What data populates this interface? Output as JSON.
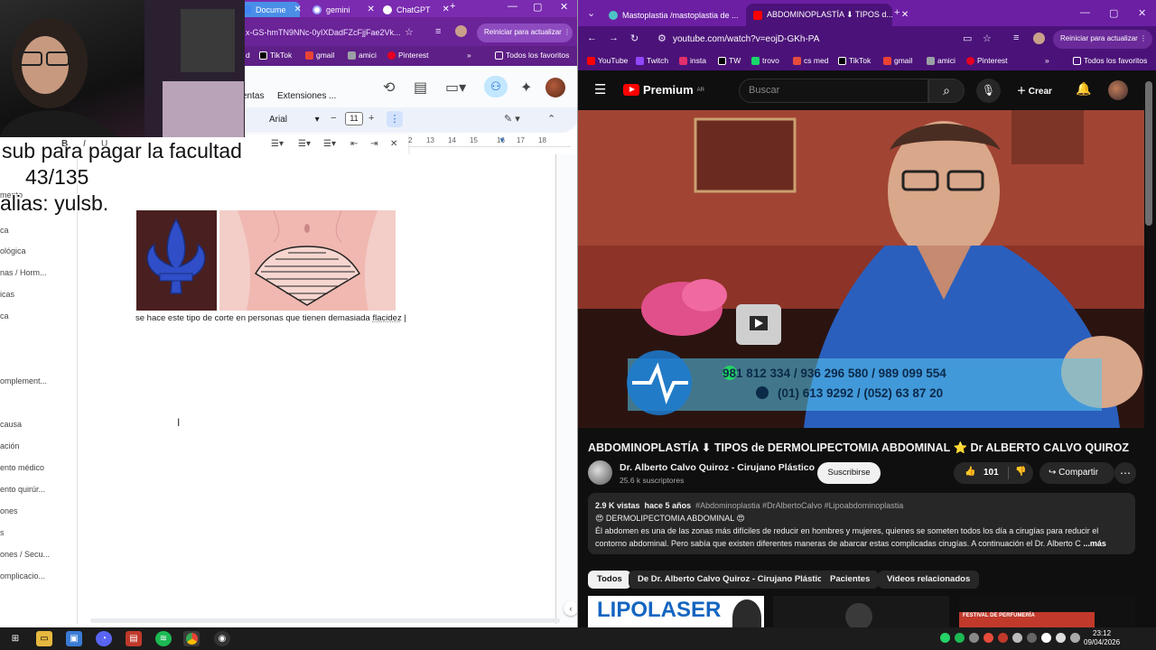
{
  "left_window": {
    "tabs": [
      {
        "label": "Docume",
        "active": true
      },
      {
        "label": "gemini",
        "active": false
      },
      {
        "label": "ChatGPT",
        "active": false
      }
    ],
    "url_fragment": "x-GS-hmTN9NNc-0yIXDadFZcFjjFae2Vk...",
    "update_button": "Reiniciar para actualizar",
    "bookmarks": [
      "d",
      "TikTok",
      "gmail",
      "amici",
      "Pinterest"
    ],
    "all_bookmarks": "Todos los favoritos",
    "menu": {
      "item_partial": "entas",
      "extensions": "Extensiones",
      "more": "..."
    },
    "toolbar": {
      "font": "Arial",
      "font_size": "11",
      "ruler_numbers": [
        "2",
        "13",
        "14",
        "15",
        "16",
        "17",
        "18"
      ]
    },
    "outline_items": [
      "mento",
      "ca",
      "ológica",
      "nas / Horm...",
      "icas",
      "ca",
      "omplement...",
      "causa",
      "ación",
      "ento médico",
      "ento quirúr...",
      "ones",
      "s",
      "ones / Secu...",
      "omplicacio..."
    ],
    "doc_text": {
      "main": "se hace este tipo de corte en personas que tienen demasiada",
      "underlined": "flacidez"
    },
    "overlay": {
      "line1": "sub para pagar la facultad",
      "line2": "43/135",
      "line3": "alias: yulsb."
    }
  },
  "right_window": {
    "tabs": [
      {
        "label": "Mastoplastia /mastoplastia de ...",
        "active": false
      },
      {
        "label": "ABDOMINOPLASTÍA ⬇ TIPOS d...",
        "active": true
      }
    ],
    "url": "youtube.com/watch?v=eojD-GKh-PA",
    "update_button": "Reiniciar para actualizar",
    "bookmarks": [
      "YouTube",
      "Twitch",
      "insta",
      "TW",
      "trovo",
      "cs med",
      "TikTok",
      "gmail",
      "amici",
      "Pinterest"
    ],
    "all_bookmarks": "Todos los favoritos",
    "youtube": {
      "logo": "Premium",
      "logo_region": "AR",
      "search_placeholder": "Buscar",
      "create_label": "Crear",
      "video_overlay": {
        "line1": "981 812 334 / 936 296 580 / 989 099 554",
        "line2": "(01) 613 9292 / (052) 63 87 20"
      },
      "title": "ABDOMINOPLASTÍA ⬇ TIPOS de DERMOLIPECTOMIA ABDOMINAL ⭐ Dr ALBERTO CALVO QUIROZ",
      "channel_name": "Dr. Alberto Calvo Quiroz - Cirujano Plástico",
      "subscribers": "25.6 k suscriptores",
      "subscribe_label": "Suscribirse",
      "likes": "101",
      "share_label": "Compartir",
      "description": {
        "views": "2.9 K vistas",
        "time": "hace 5 años",
        "hashtags": "#Abdominoplastia #DrAlbertoCalvo #Lipoabdominoplastia",
        "subtitle": "😍 DERMOLIPECTOMIA ABDOMINAL 😍",
        "line1": "Él abdomen es una de las zonas más difíciles de reducir en  hombres y mujeres, quienes se someten todos los día a cirugías para reducir el",
        "line2": "contorno abdominal. Pero sabía que existen diferentes maneras de abarcar estas complicadas cirugías. A continuación el Dr. Alberto C",
        "more": "...más"
      },
      "chips": [
        "Todos",
        "De Dr. Alberto Calvo Quiroz - Cirujano Plástico",
        "Pacientes",
        "Videos relacionados"
      ],
      "thumb_label": "LIPOLASER",
      "thumb3_label": "FESTIVAL DE PERFUMERÍA"
    }
  },
  "taskbar": {
    "time": "23:12",
    "date": "09/04/2026"
  },
  "colors": {
    "left_tabbar": "#7a2bb0",
    "right_tabbar": "#6c1fa3",
    "yt_bg": "#0f0f0f",
    "yt_red": "#ff0000",
    "docs_blue": "#0b57d0"
  }
}
